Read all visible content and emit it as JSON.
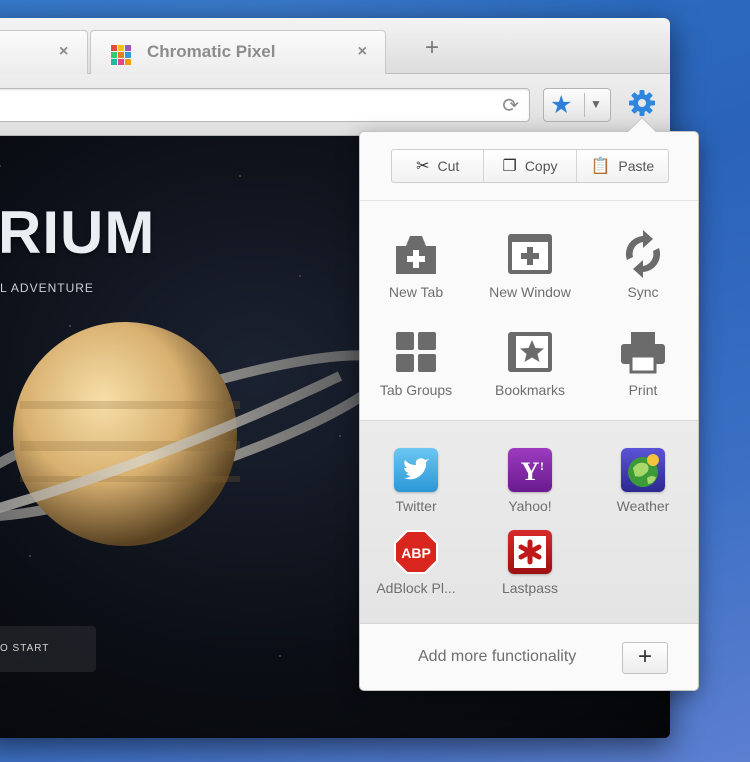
{
  "tabs": [
    {
      "title": ""
    },
    {
      "title": "Chromatic Pixel"
    }
  ],
  "toolbar": {
    "new_tab_symbol": "+"
  },
  "page": {
    "hero_title": "RIUM",
    "hero_subtitle": "L ADVENTURE",
    "start_button": "O START"
  },
  "menu": {
    "edit": [
      {
        "label": "Cut",
        "icon": "scissors-icon"
      },
      {
        "label": "Copy",
        "icon": "copy-icon"
      },
      {
        "label": "Paste",
        "icon": "paste-icon"
      }
    ],
    "actions": [
      {
        "label": "New Tab",
        "icon": "new-tab-icon"
      },
      {
        "label": "New Window",
        "icon": "new-window-icon"
      },
      {
        "label": "Sync",
        "icon": "sync-icon"
      },
      {
        "label": "Tab Groups",
        "icon": "tab-groups-icon"
      },
      {
        "label": "Bookmarks",
        "icon": "bookmarks-icon"
      },
      {
        "label": "Print",
        "icon": "print-icon"
      }
    ],
    "apps": [
      {
        "label": "Twitter",
        "icon": "twitter-icon",
        "color": "#3aa9e0"
      },
      {
        "label": "Yahoo!",
        "icon": "yahoo-icon",
        "color": "#7b1fa2"
      },
      {
        "label": "Weather",
        "icon": "weather-icon",
        "color": "#4a3bb5"
      },
      {
        "label": "AdBlock Pl...",
        "icon": "adblock-icon",
        "color": "#d8261f"
      },
      {
        "label": "Lastpass",
        "icon": "lastpass-icon",
        "color": "#c01818"
      }
    ],
    "footer_text": "Add more functionality",
    "add_symbol": "+"
  },
  "colors": {
    "accent": "#2f7fd9",
    "desktop": "#2f6fc4"
  }
}
